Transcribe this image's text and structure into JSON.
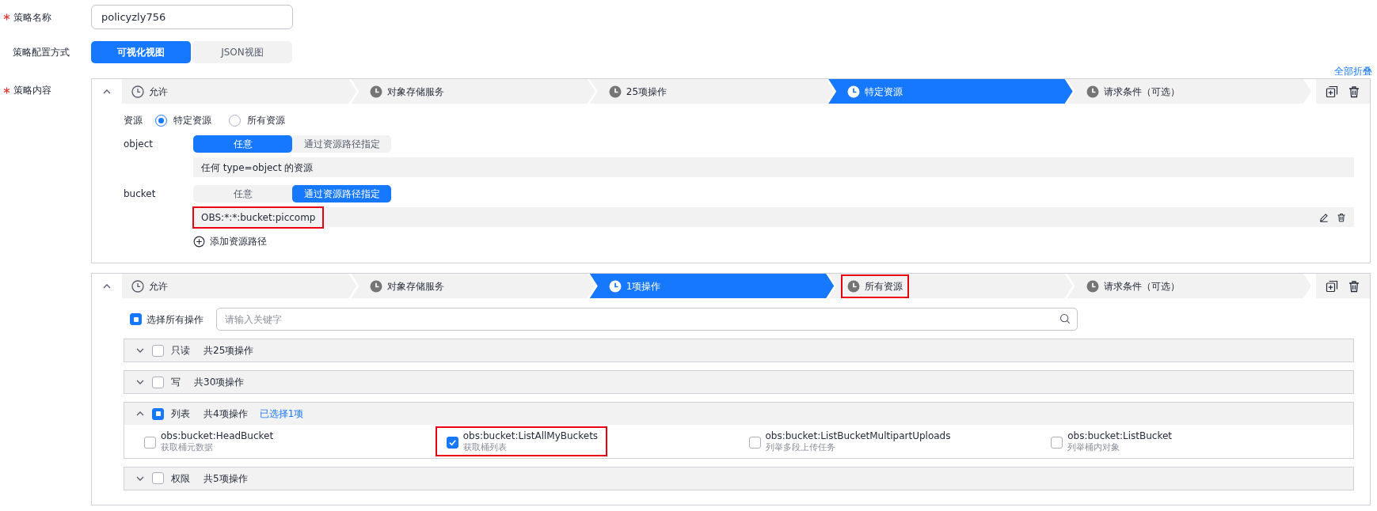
{
  "policy_name": {
    "label": "策略名称",
    "required": true,
    "value": "policyzly756"
  },
  "config_mode": {
    "label": "策略配置方式",
    "options": [
      {
        "label": "可视化视图",
        "selected": true
      },
      {
        "label": "JSON视图",
        "selected": false
      }
    ]
  },
  "policy_content": {
    "label": "策略内容",
    "required": true,
    "collapse_all": "全部折叠",
    "statements": [
      {
        "kind": "resources",
        "expanded": true,
        "steps": [
          {
            "label": "允许",
            "selected": false,
            "highlighted": false
          },
          {
            "label": "对象存储服务",
            "selected": false,
            "highlighted": false
          },
          {
            "label": "25项操作",
            "selected": false,
            "highlighted": false
          },
          {
            "label": "特定资源",
            "selected": true,
            "highlighted": false
          },
          {
            "label": "请求条件（可选）",
            "selected": false,
            "highlighted": false
          }
        ],
        "resource": {
          "label": "资源",
          "options": [
            {
              "label": "特定资源",
              "selected": true
            },
            {
              "label": "所有资源",
              "selected": false
            }
          ]
        },
        "resource_types": [
          {
            "name": "object",
            "modes": [
              {
                "label": "任意",
                "selected": true
              },
              {
                "label": "通过资源路径指定",
                "selected": false
              }
            ],
            "values": [
              {
                "text": "任何 type=object 的资源",
                "highlighted": false,
                "editable": false
              }
            ]
          },
          {
            "name": "bucket",
            "modes": [
              {
                "label": "任意",
                "selected": false
              },
              {
                "label": "通过资源路径指定",
                "selected": true
              }
            ],
            "values": [
              {
                "text": "OBS:*:*:bucket:piccomp",
                "highlighted": true,
                "editable": true
              }
            ],
            "add_path": "添加资源路径"
          }
        ]
      },
      {
        "kind": "actions",
        "expanded": true,
        "steps": [
          {
            "label": "允许",
            "selected": false,
            "highlighted": false
          },
          {
            "label": "对象存储服务",
            "selected": false,
            "highlighted": false
          },
          {
            "label": "1项操作",
            "selected": true,
            "highlighted": false
          },
          {
            "label": "所有资源",
            "selected": false,
            "highlighted": true
          },
          {
            "label": "请求条件（可选）",
            "selected": false,
            "highlighted": false
          }
        ],
        "select_all": {
          "label": "选择所有操作",
          "checked": false,
          "indeterminate": true
        },
        "search": {
          "placeholder": "请输入关键字"
        },
        "groups": [
          {
            "name": "只读",
            "count": "共25项操作",
            "expanded": false,
            "checked": false,
            "indeterminate": false
          },
          {
            "name": "写",
            "count": "共30项操作",
            "expanded": false,
            "checked": false,
            "indeterminate": false
          },
          {
            "name": "列表",
            "count": "共4项操作",
            "selected_count": "已选择1项",
            "expanded": true,
            "checked": false,
            "indeterminate": true,
            "actions": [
              {
                "name": "obs:bucket:HeadBucket",
                "description": "获取桶元数据",
                "checked": false,
                "highlighted": false
              },
              {
                "name": "obs:bucket:ListAllMyBuckets",
                "description": "获取桶列表",
                "checked": true,
                "highlighted": true
              },
              {
                "name": "obs:bucket:ListBucketMultipartUploads",
                "description": "列举多段上传任务",
                "checked": false,
                "highlighted": false
              },
              {
                "name": "obs:bucket:ListBucket",
                "description": "列举桶内对象",
                "checked": false,
                "highlighted": false
              }
            ]
          },
          {
            "name": "权限",
            "count": "共5项操作",
            "expanded": false,
            "checked": false,
            "indeterminate": false
          }
        ]
      }
    ]
  }
}
